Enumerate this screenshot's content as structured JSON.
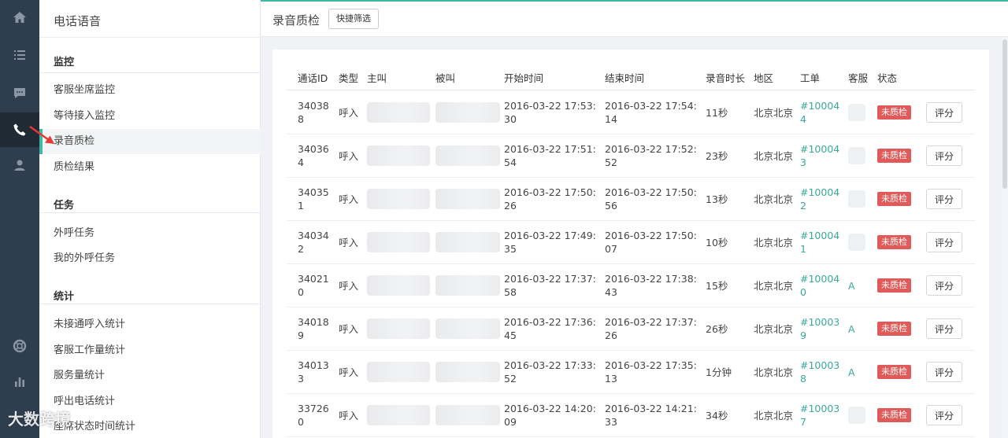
{
  "colors": {
    "rail_bg": "#2e3e4e",
    "accent": "#3fb8a6",
    "badge_red": "#e05a5a",
    "link_teal": "#3aa89a"
  },
  "rail": {
    "items": [
      {
        "icon": "home-icon"
      },
      {
        "icon": "list-icon"
      },
      {
        "icon": "chat-icon"
      },
      {
        "icon": "phone-icon",
        "active": true
      },
      {
        "icon": "user-icon"
      },
      {
        "icon": "lifebuoy-icon"
      },
      {
        "icon": "bar-chart-icon"
      }
    ]
  },
  "sidebar": {
    "title": "电话语音",
    "groups": [
      {
        "title": "监控",
        "items": [
          "客服坐席监控",
          "等待接入监控",
          "录音质检",
          "质检结果"
        ]
      },
      {
        "title": "任务",
        "items": [
          "外呼任务",
          "我的外呼任务"
        ]
      },
      {
        "title": "统计",
        "items": [
          "未接通呼入统计",
          "客服工作量统计",
          "服务量统计",
          "呼出电话统计",
          "座席状态时间统计"
        ]
      }
    ],
    "active_item": "录音质检"
  },
  "header": {
    "title": "录音质检",
    "quick_filter_label": "快捷筛选"
  },
  "table": {
    "columns": {
      "id": "通话ID",
      "type": "类型",
      "caller": "主叫",
      "callee": "被叫",
      "start": "开始时间",
      "end": "结束时间",
      "duration": "录音时长",
      "area": "地区",
      "ticket": "工单",
      "agent": "客服",
      "status": "状态"
    },
    "rows": [
      {
        "id": "340388",
        "type": "呼入",
        "start": "2016-03-22 17:53:30",
        "end": "2016-03-22 17:54:14",
        "duration": "11秒",
        "area": "北京北京",
        "ticket": "#100044",
        "agent": "",
        "status": "未质检",
        "action": "评分"
      },
      {
        "id": "340364",
        "type": "呼入",
        "start": "2016-03-22 17:51:54",
        "end": "2016-03-22 17:52:52",
        "duration": "23秒",
        "area": "北京北京",
        "ticket": "#100043",
        "agent": "",
        "status": "未质检",
        "action": "评分"
      },
      {
        "id": "340351",
        "type": "呼入",
        "start": "2016-03-22 17:50:26",
        "end": "2016-03-22 17:50:56",
        "duration": "13秒",
        "area": "北京北京",
        "ticket": "#100042",
        "agent": "",
        "status": "未质检",
        "action": "评分"
      },
      {
        "id": "340342",
        "type": "呼入",
        "start": "2016-03-22 17:49:35",
        "end": "2016-03-22 17:50:07",
        "duration": "10秒",
        "area": "北京北京",
        "ticket": "#100041",
        "agent": "",
        "status": "未质检",
        "action": "评分"
      },
      {
        "id": "340210",
        "type": "呼入",
        "start": "2016-03-22 17:37:58",
        "end": "2016-03-22 17:38:43",
        "duration": "15秒",
        "area": "北京北京",
        "ticket": "#100040",
        "agent": "A",
        "status": "未质检",
        "action": "评分"
      },
      {
        "id": "340189",
        "type": "呼入",
        "start": "2016-03-22 17:36:45",
        "end": "2016-03-22 17:37:26",
        "duration": "26秒",
        "area": "北京北京",
        "ticket": "#100039",
        "agent": "A",
        "status": "未质检",
        "action": "评分"
      },
      {
        "id": "340133",
        "type": "呼入",
        "start": "2016-03-22 17:33:52",
        "end": "2016-03-22 17:35:13",
        "duration": "1分钟",
        "area": "北京北京",
        "ticket": "#100038",
        "agent": "A",
        "status": "未质检",
        "action": "评分"
      },
      {
        "id": "337260",
        "type": "呼入",
        "start": "2016-03-22 14:20:09",
        "end": "2016-03-22 14:21:33",
        "duration": "34秒",
        "area": "北京北京",
        "ticket": "#100037",
        "agent": "",
        "status": "未质检",
        "action": "评分"
      }
    ]
  },
  "watermark": "大数跨境"
}
